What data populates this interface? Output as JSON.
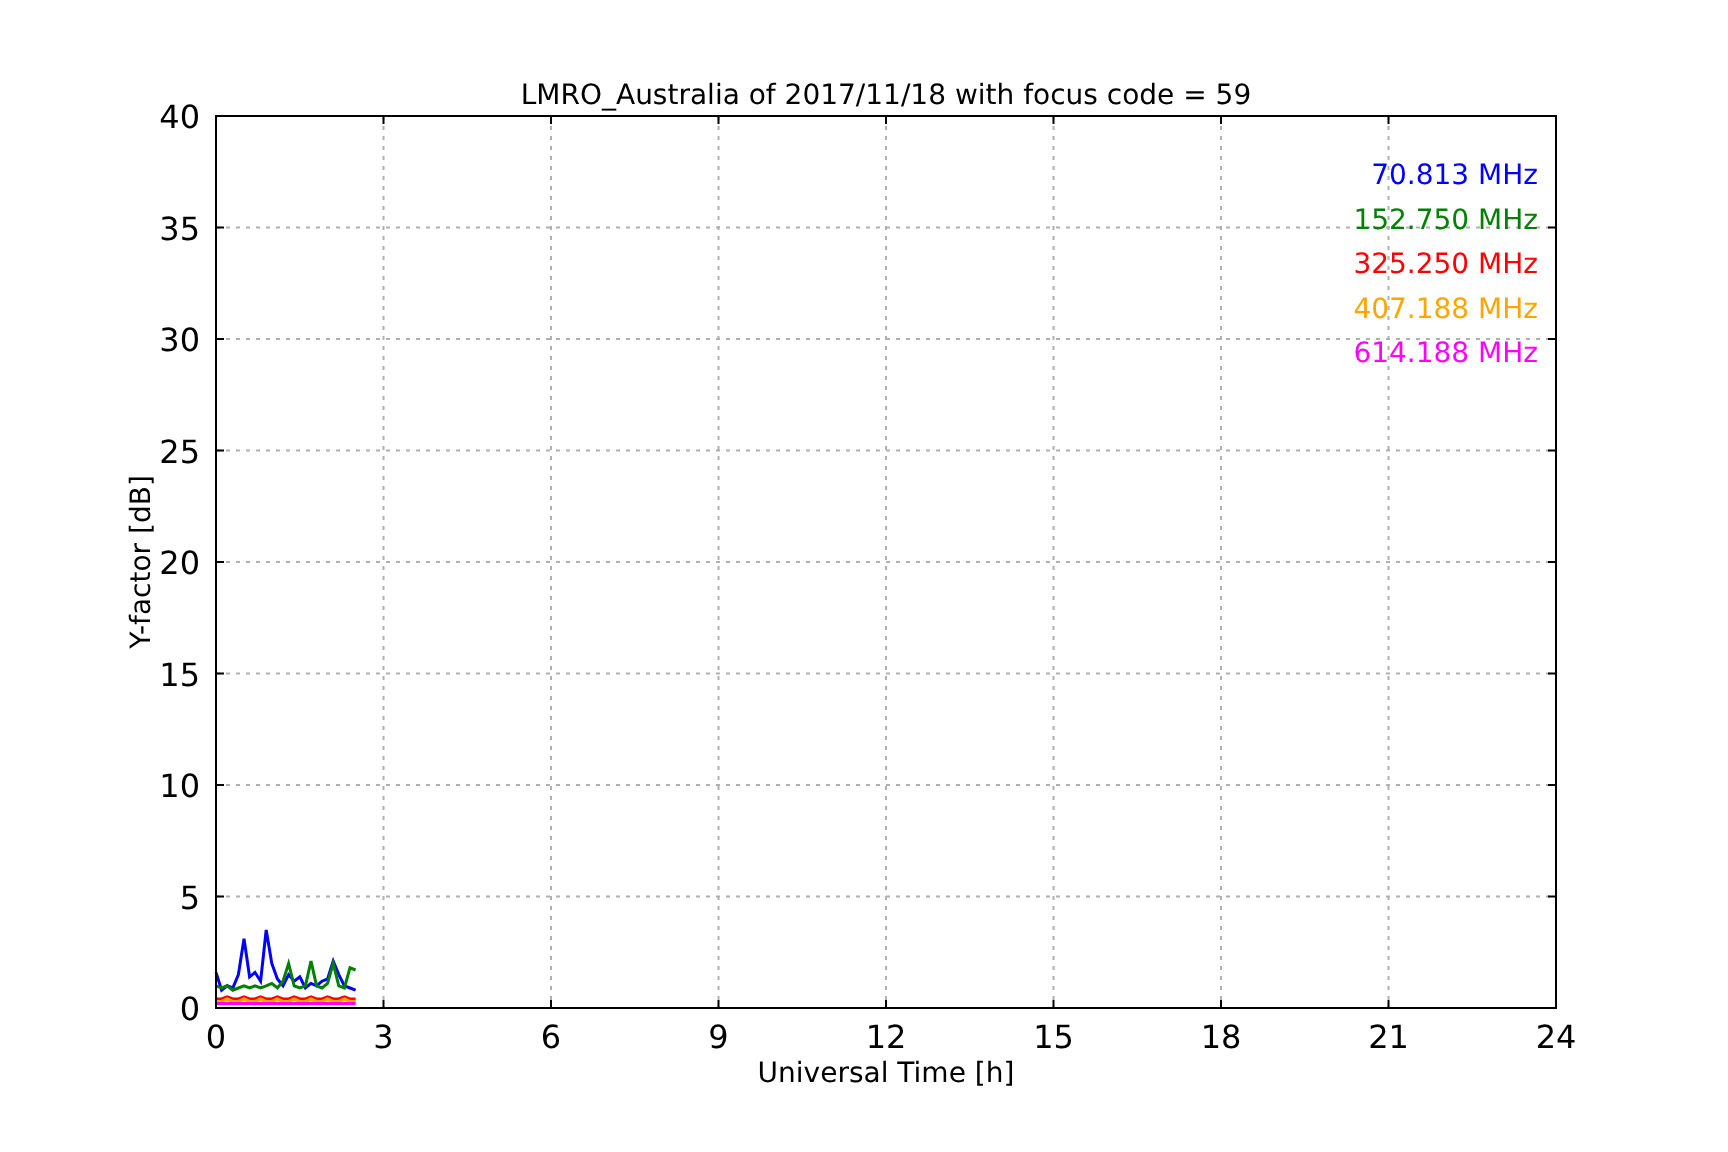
{
  "chart_data": {
    "type": "line",
    "title": "LMRO_Australia of 2017/11/18 with focus code = 59",
    "xlabel": "Universal Time [h]",
    "ylabel": "Y-factor [dB]",
    "x": [
      0,
      0.1,
      0.2,
      0.3,
      0.4,
      0.5,
      0.6,
      0.7,
      0.8,
      0.9,
      1.0,
      1.1,
      1.2,
      1.3,
      1.4,
      1.5,
      1.6,
      1.7,
      1.8,
      1.9,
      2.0,
      2.1,
      2.2,
      2.3,
      2.4,
      2.5
    ],
    "series": [
      {
        "name": "70.813 MHz",
        "color": "#0000ff",
        "values": [
          1.6,
          0.8,
          1.0,
          0.9,
          1.5,
          3.1,
          1.4,
          1.6,
          1.2,
          3.5,
          2.0,
          1.3,
          1.0,
          1.5,
          1.2,
          1.4,
          0.9,
          1.1,
          1.0,
          1.2,
          1.3,
          2.1,
          1.5,
          1.0,
          0.9,
          0.8
        ]
      },
      {
        "name": "152.750 MHz",
        "color": "#008000",
        "values": [
          1.0,
          0.9,
          1.0,
          0.8,
          0.9,
          1.0,
          0.9,
          1.0,
          0.9,
          1.0,
          1.1,
          0.9,
          1.2,
          2.0,
          1.0,
          0.9,
          1.0,
          2.1,
          1.0,
          0.9,
          1.1,
          2.0,
          1.0,
          0.9,
          1.8,
          1.7
        ]
      },
      {
        "name": "325.250 MHz",
        "color": "#ff0000",
        "values": [
          0.4,
          0.4,
          0.5,
          0.4,
          0.4,
          0.5,
          0.4,
          0.4,
          0.5,
          0.4,
          0.4,
          0.5,
          0.4,
          0.4,
          0.5,
          0.4,
          0.4,
          0.5,
          0.4,
          0.4,
          0.5,
          0.4,
          0.4,
          0.5,
          0.4,
          0.4
        ]
      },
      {
        "name": "407.188 MHz",
        "color": "#ffa500",
        "values": [
          0.3,
          0.3,
          0.4,
          0.3,
          0.3,
          0.4,
          0.3,
          0.3,
          0.4,
          0.3,
          0.3,
          0.4,
          0.3,
          0.3,
          0.4,
          0.3,
          0.3,
          0.4,
          0.3,
          0.3,
          0.4,
          0.3,
          0.3,
          0.4,
          0.3,
          0.3
        ]
      },
      {
        "name": "614.188 MHz",
        "color": "#ff00ff",
        "values": [
          0.2,
          0.2,
          0.2,
          0.2,
          0.2,
          0.2,
          0.2,
          0.2,
          0.2,
          0.2,
          0.2,
          0.2,
          0.2,
          0.2,
          0.2,
          0.2,
          0.2,
          0.2,
          0.2,
          0.2,
          0.2,
          0.2,
          0.2,
          0.2,
          0.2,
          0.2
        ]
      }
    ],
    "grid": true,
    "xlim": [
      0,
      24
    ],
    "ylim": [
      0,
      40
    ],
    "xticks": [
      0,
      3,
      6,
      9,
      12,
      15,
      18,
      21,
      24
    ],
    "yticks": [
      0,
      5,
      10,
      15,
      20,
      25,
      30,
      35,
      40
    ]
  }
}
